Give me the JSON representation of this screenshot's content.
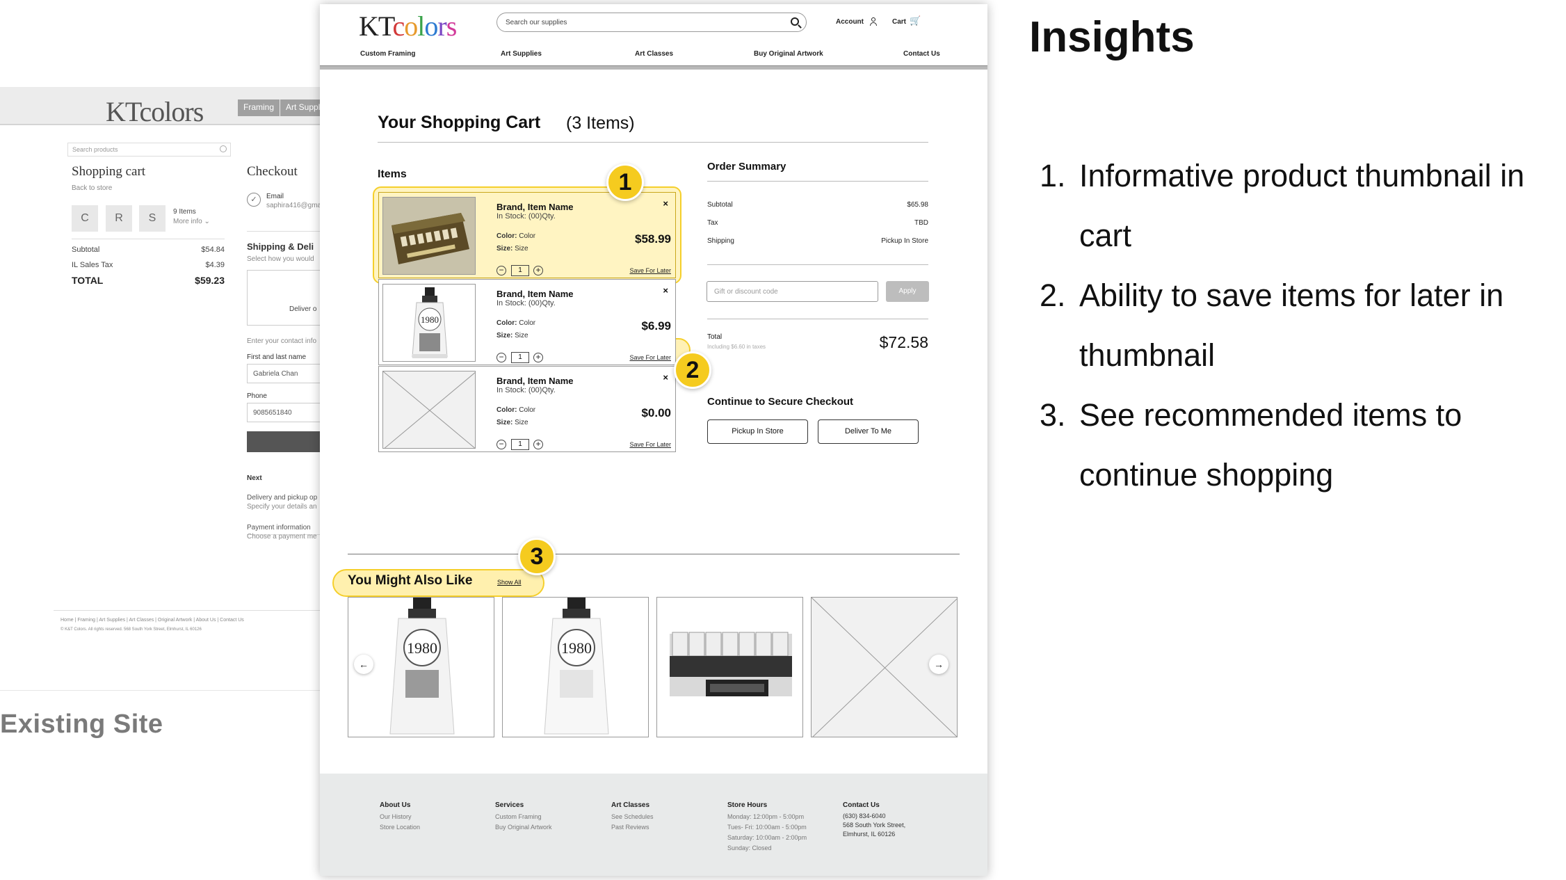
{
  "old_site": {
    "logo": "KTcolors",
    "nav": [
      "Framing",
      "Art Supplies"
    ],
    "search_placeholder": "Search products",
    "cart_title": "Shopping cart",
    "back_link": "Back to store",
    "thumbs": [
      "C",
      "R",
      "S"
    ],
    "items_count": "9 Items",
    "more_info": "More info",
    "subtotal_label": "Subtotal",
    "subtotal_value": "$54.84",
    "tax_label": "IL Sales Tax",
    "tax_value": "$4.39",
    "total_label": "TOTAL",
    "total_value": "$59.23",
    "checkout_title": "Checkout",
    "email_label": "Email",
    "email_value": "saphira416@gma",
    "shipping_title": "Shipping & Deli",
    "shipping_sub": "Select how you would",
    "deliver_option": "Deliver o",
    "contact_info": "Enter your contact info",
    "name_label": "First and last name",
    "name_value": "Gabriela Chan",
    "phone_label": "Phone",
    "phone_value": "9085651840",
    "next_label": "Next",
    "next_1_title": "Delivery and pickup op",
    "next_1_sub": "Specify your details an",
    "next_2_title": "Payment information",
    "next_2_sub": "Choose a payment me",
    "footer_links": "Home  |  Framing  |  Art Supplies  |  Art Classes  |  Original Artwork  |  About Us  |  Contact Us",
    "footer_copy": "© K&T Colors. All rights reserved. 568 South York Street, Elmhurst, IL 60126"
  },
  "existing_label": "Existing Site",
  "mockup": {
    "search_placeholder": "Search our supplies",
    "account_label": "Account",
    "cart_label": "Cart",
    "nav": [
      "Custom Framing",
      "Art Supplies",
      "Art Classes",
      "Buy Original Artwork",
      "Contact Us"
    ],
    "cart_title": "Your Shopping Cart",
    "cart_count": "(3 Items)",
    "items_label": "Items",
    "items": [
      {
        "name": "Brand, Item Name",
        "stock": "In Stock: (00)Qty.",
        "color_label": "Color:",
        "color": "Color",
        "size_label": "Size:",
        "size": "Size",
        "price": "$58.99",
        "qty": "1",
        "save": "Save For Later"
      },
      {
        "name": "Brand, Item Name",
        "stock": "In Stock: (00)Qty.",
        "color_label": "Color:",
        "color": "Color",
        "size_label": "Size:",
        "size": "Size",
        "price": "$6.99",
        "qty": "1",
        "save": "Save For Later"
      },
      {
        "name": "Brand, Item Name",
        "stock": "In Stock: (00)Qty.",
        "color_label": "Color:",
        "color": "Color",
        "size_label": "Size:",
        "size": "Size",
        "price": "$0.00",
        "qty": "1",
        "save": "Save For Later"
      }
    ],
    "summary": {
      "title": "Order Summary",
      "subtotal_label": "Subtotal",
      "subtotal_value": "$65.98",
      "tax_label": "Tax",
      "tax_value": "TBD",
      "shipping_label": "Shipping",
      "shipping_value": "Pickup In Store",
      "gift_placeholder": "Gift or discount code",
      "apply_label": "Apply",
      "total_label": "Total",
      "total_sub": "Including $6.60 in taxes",
      "total_value": "$72.58",
      "checkout_title": "Continue to Secure Checkout",
      "pickup_btn": "Pickup In Store",
      "deliver_btn": "Deliver To Me"
    },
    "recommend": {
      "title": "You Might Also Like",
      "show_all": "Show All"
    },
    "footer": [
      {
        "title": "About Us",
        "links": [
          "Our History",
          "Store Location"
        ]
      },
      {
        "title": "Services",
        "links": [
          "Custom Framing",
          "Buy Original Artwork"
        ]
      },
      {
        "title": "Art Classes",
        "links": [
          "See Schedules",
          "Past Reviews"
        ]
      },
      {
        "title": "Store Hours",
        "links": [
          "Monday: 12:00pm - 5:00pm",
          "Tues- Fri: 10:00am - 5:00pm",
          "Saturday:  10:00am - 2:00pm",
          "Sunday: Closed"
        ]
      }
    ],
    "contact": {
      "title": "Contact Us",
      "phone": "(630) 834-6040",
      "address1": "568 South York Street,",
      "address2": "Elmhurst, IL 60126"
    },
    "badges": [
      "1",
      "2",
      "3"
    ],
    "product_labels": {
      "tube": "1980"
    }
  },
  "insights": {
    "title": "Insights",
    "items": [
      {
        "num": "1.",
        "text": "Informative product thumbnail in cart"
      },
      {
        "num": "2.",
        "text": "Ability to save items for later in thumbnail"
      },
      {
        "num": "3.",
        "text": "See recommended items to continue shopping"
      }
    ]
  },
  "colors": {
    "highlight": "#f5cb1f",
    "footer_bg": "#e8eaea"
  }
}
